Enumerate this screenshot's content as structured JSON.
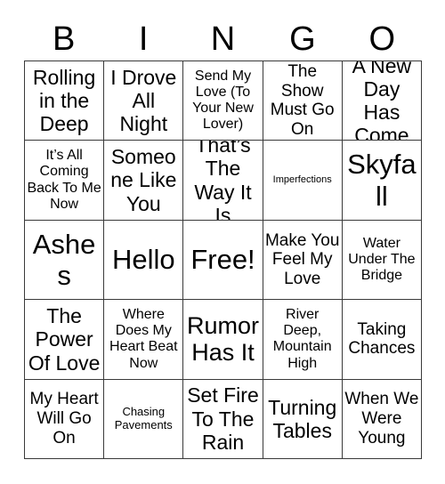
{
  "card": {
    "header_letters": [
      "B",
      "I",
      "N",
      "G",
      "O"
    ],
    "columns": 5,
    "rows": 5,
    "colors": {
      "background": "#ffffff",
      "text": "#000000",
      "grid_line": "#3a3a3a"
    },
    "cells": [
      {
        "text": "Rolling in the Deep",
        "size": "lg",
        "free_space": false
      },
      {
        "text": "I Drove All Night",
        "size": "lg",
        "free_space": false
      },
      {
        "text": "Send My Love (To Your New Lover)",
        "size": "sm",
        "free_space": false
      },
      {
        "text": "The Show Must Go On",
        "size": "md",
        "free_space": false
      },
      {
        "text": "A New Day Has Come",
        "size": "lg",
        "free_space": false
      },
      {
        "text": "It’s All Coming Back To Me Now",
        "size": "sm",
        "free_space": false
      },
      {
        "text": "Someone Like You",
        "size": "lg",
        "free_space": false
      },
      {
        "text": "That’s The Way It Is",
        "size": "lg",
        "free_space": false
      },
      {
        "text": "Imperfections",
        "size": "xxs",
        "free_space": false
      },
      {
        "text": "Skyfall",
        "size": "xxl",
        "free_space": false
      },
      {
        "text": "Ashes",
        "size": "xxl",
        "free_space": false
      },
      {
        "text": "Hello",
        "size": "xxl",
        "free_space": false
      },
      {
        "text": "Free!",
        "size": "xxl",
        "free_space": true
      },
      {
        "text": "Make You Feel My Love",
        "size": "md",
        "free_space": false
      },
      {
        "text": "Water Under The Bridge",
        "size": "sm",
        "free_space": false
      },
      {
        "text": "The Power Of Love",
        "size": "lg",
        "free_space": false
      },
      {
        "text": "Where Does My Heart Beat Now",
        "size": "sm",
        "free_space": false
      },
      {
        "text": "Rumor Has It",
        "size": "xl",
        "free_space": false
      },
      {
        "text": "River Deep, Mountain High",
        "size": "sm",
        "free_space": false
      },
      {
        "text": "Taking Chances",
        "size": "md",
        "free_space": false
      },
      {
        "text": "My Heart Will Go On",
        "size": "md",
        "free_space": false
      },
      {
        "text": "Chasing Pavements",
        "size": "xs",
        "free_space": false
      },
      {
        "text": "Set Fire To The Rain",
        "size": "lg",
        "free_space": false
      },
      {
        "text": "Turning Tables",
        "size": "lg",
        "free_space": false
      },
      {
        "text": "When We Were Young",
        "size": "md",
        "free_space": false
      }
    ]
  }
}
